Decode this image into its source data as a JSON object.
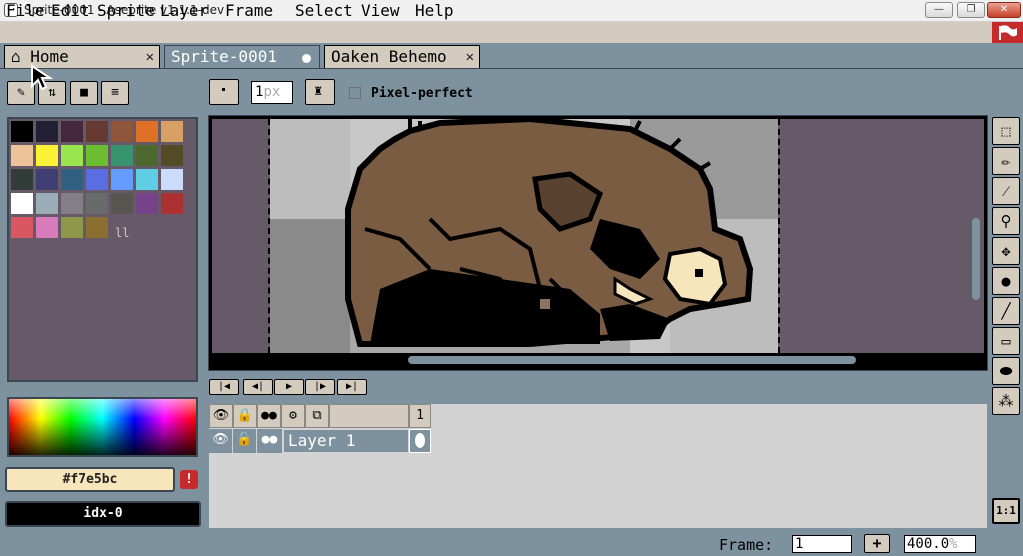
{
  "window": {
    "title": "Sprite-0001 - Aseprite v1.1.1-dev",
    "minimize": "—",
    "maximize": "❐",
    "close": "✕"
  },
  "menu": [
    "File",
    "Edit",
    "Sprite",
    "Layer",
    "Frame",
    "Select",
    "View",
    "Help"
  ],
  "tabs": {
    "home": "Home",
    "sprite": "Sprite-0001",
    "oaken": "Oaken Behemo",
    "close": "✕"
  },
  "context_bar": {
    "brush_size": "1",
    "brush_unit": "px",
    "pixel_perfect": "Pixel-perfect"
  },
  "palette": {
    "colors": [
      "#000000",
      "#222034",
      "#45283c",
      "#663931",
      "#8f563b",
      "#df7126",
      "#d9a066",
      "#eec39a",
      "#fbf236",
      "#99e550",
      "#6abe30",
      "#37946e",
      "#4b692f",
      "#524b24",
      "#323c39",
      "#3f3f74",
      "#306082",
      "#5b6ee1",
      "#639bff",
      "#5fcde4",
      "#cbdbfc",
      "#ffffff",
      "#9badb7",
      "#847e87",
      "#696a6a",
      "#595652",
      "#76428a",
      "#ac3232",
      "#d95763",
      "#d77bba",
      "#8f974a",
      "#8a6f30"
    ],
    "drag_handle": "ll"
  },
  "colors": {
    "foreground": "#f7e5bc",
    "foreground_label": "#f7e5bc",
    "warning": "!",
    "background_label": "idx-0"
  },
  "timeline": {
    "frame_number": "1",
    "layer_name": "Layer 1"
  },
  "status": {
    "frame_label": "Frame:",
    "frame_value": "1",
    "add_frame": "+",
    "zoom": "400.0",
    "zoom_unit": "%"
  },
  "ratio": "1:1"
}
